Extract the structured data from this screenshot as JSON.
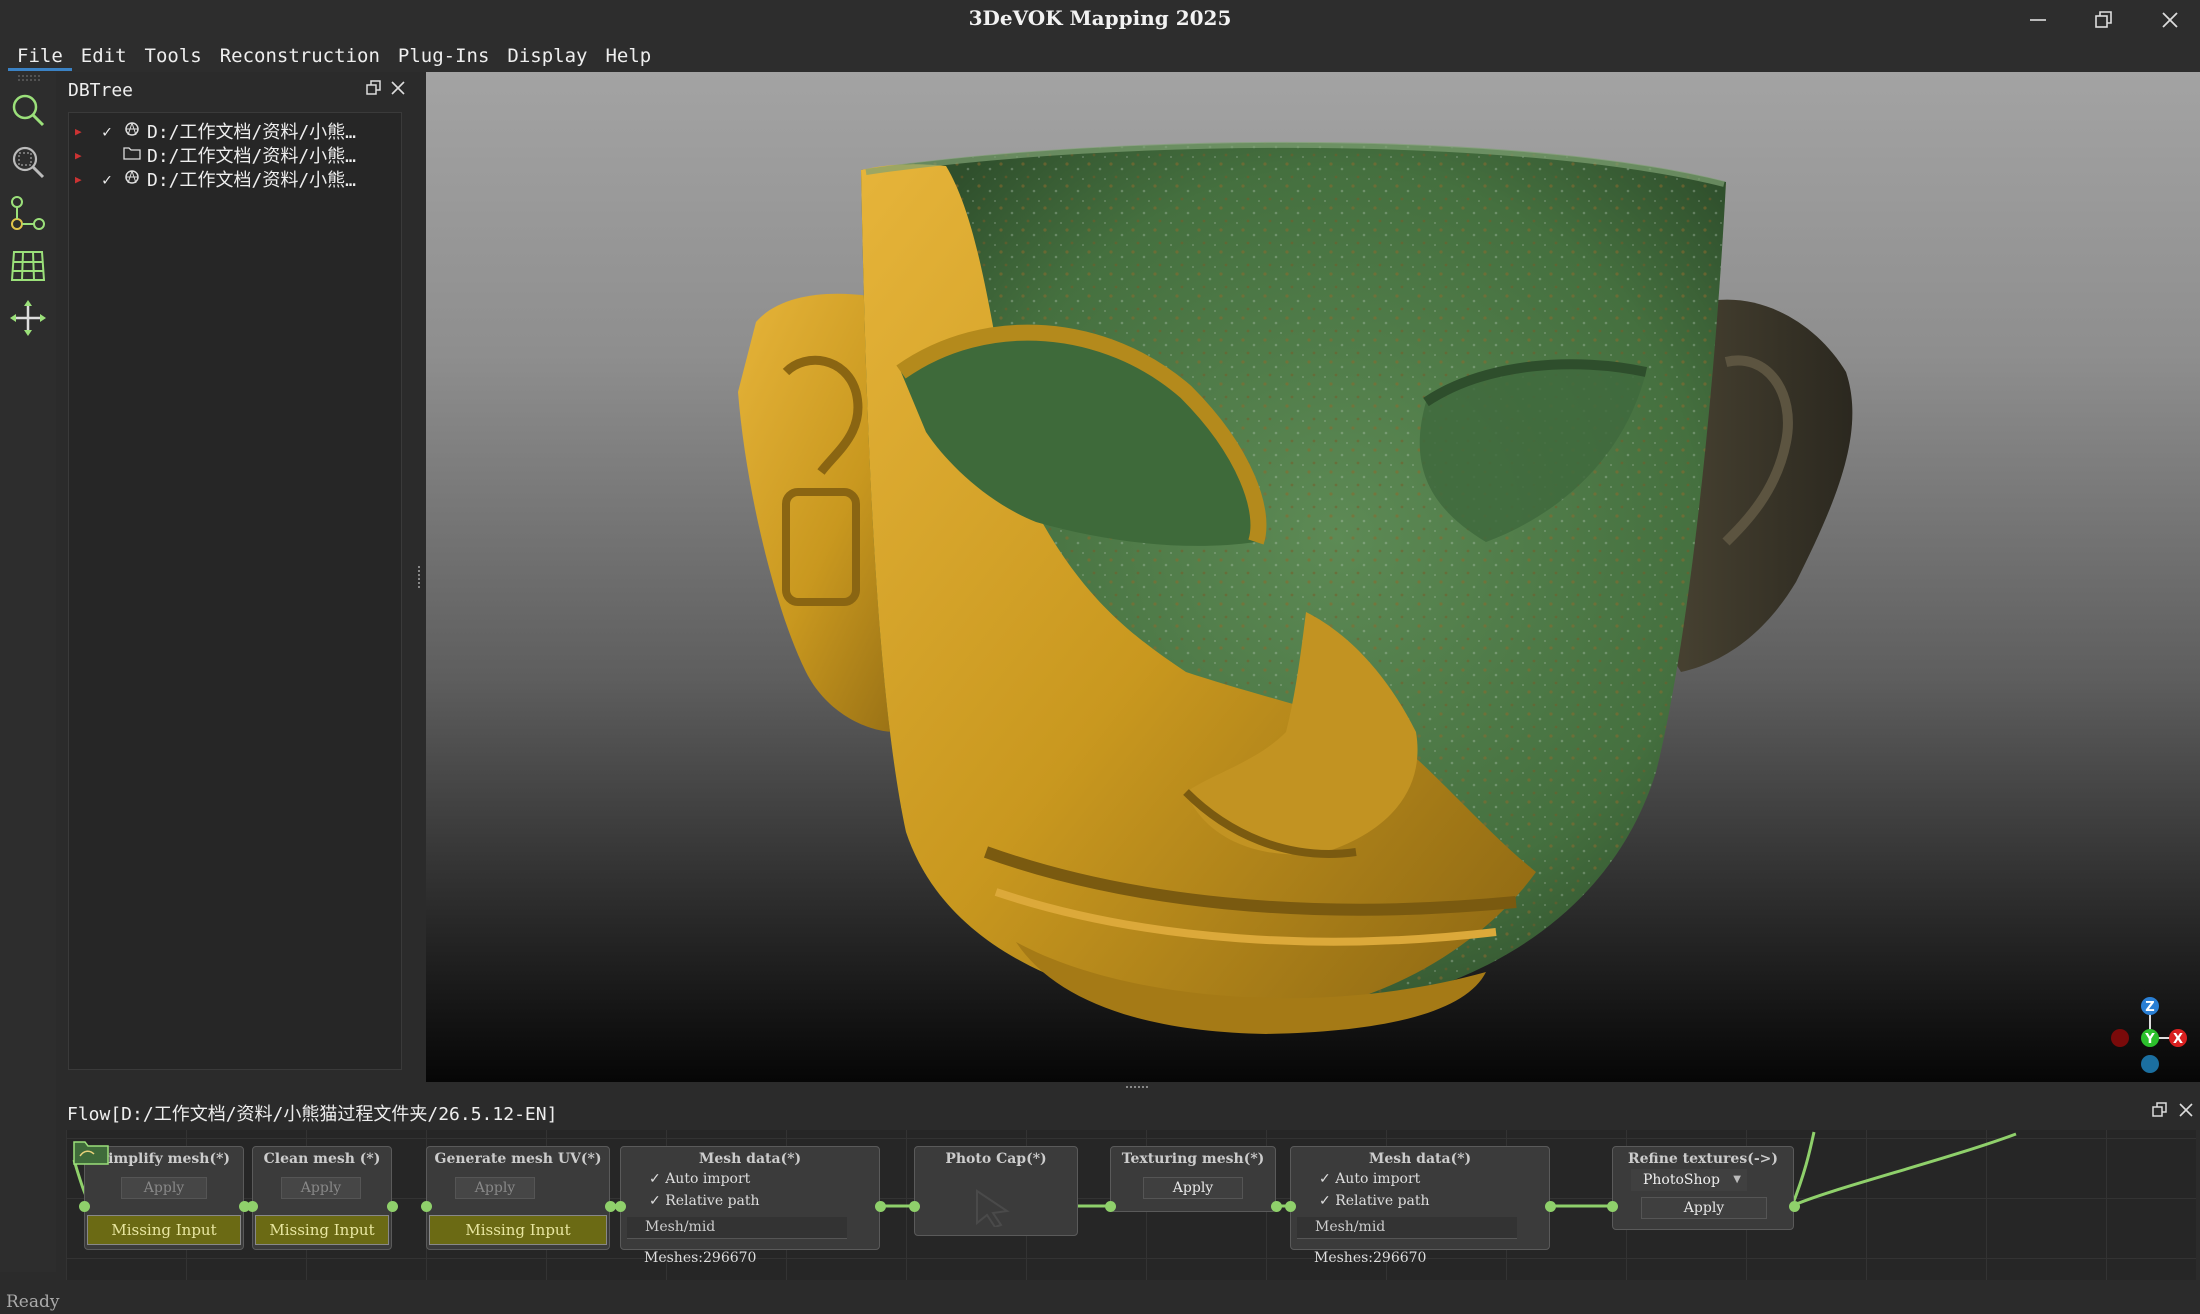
{
  "window": {
    "title": "3DeVOK Mapping 2025",
    "controls": [
      "minimize",
      "restore",
      "close"
    ]
  },
  "menu": {
    "items": [
      "File",
      "Edit",
      "Tools",
      "Reconstruction",
      "Plug-Ins",
      "Display",
      "Help"
    ],
    "active": "File"
  },
  "toolbar": {
    "tools": [
      "search-icon",
      "zoom-fit-icon",
      "node-graph-icon",
      "mesh-grid-icon",
      "move-icon"
    ]
  },
  "dbtree": {
    "title": "DBTree",
    "items": [
      {
        "label": "D:/工作文档/资料/小熊…",
        "checked": true,
        "icon": "mesh-object-icon"
      },
      {
        "label": "D:/工作文档/资料/小熊…",
        "checked": false,
        "icon": "folder-icon"
      },
      {
        "label": "D:/工作文档/资料/小熊…",
        "checked": true,
        "icon": "mesh-object-icon"
      }
    ]
  },
  "viewport": {
    "object": "bronze-mask-3d-model",
    "colors": {
      "gold": "#c9981f",
      "patina": "#4f7a45",
      "dark_ear": "#3f3a2a"
    },
    "axes": {
      "z_label": "Z",
      "y_label": "Y",
      "x_label": "X",
      "x_color": "#d92020",
      "y_color": "#2cc02c",
      "z_color": "#2a7fd4"
    }
  },
  "flow": {
    "title": "Flow[D:/工作文档/资料/小熊猫过程文件夹/26.5.12-EN]",
    "nodes": {
      "simplify": {
        "title": "Simplify mesh(*)",
        "apply": "Apply",
        "status": "Missing Input"
      },
      "clean": {
        "title": "Clean mesh (*)",
        "apply": "Apply",
        "status": "Missing Input"
      },
      "uv": {
        "title": "Generate mesh UV(*)",
        "apply": "Apply",
        "status": "Missing Input"
      },
      "mesh1": {
        "title": "Mesh data(*)",
        "auto_import": "Auto import",
        "relative_path": "Relative path",
        "field": "Mesh/mid",
        "meshes": "Meshes:296670"
      },
      "photocap": {
        "title": "Photo Cap(*)"
      },
      "texturing": {
        "title": "Texturing mesh(*)",
        "apply": "Apply"
      },
      "mesh2": {
        "title": "Mesh data(*)",
        "auto_import": "Auto import",
        "relative_path": "Relative path",
        "field": "Mesh/mid",
        "meshes": "Meshes:296670"
      },
      "refine": {
        "title": "Refine textures(->)",
        "dropdown": "PhotoShop",
        "apply": "Apply"
      }
    },
    "colors": {
      "missing_input": "#6b6a14",
      "link": "#8fd06b"
    }
  },
  "status": {
    "text": "Ready"
  }
}
